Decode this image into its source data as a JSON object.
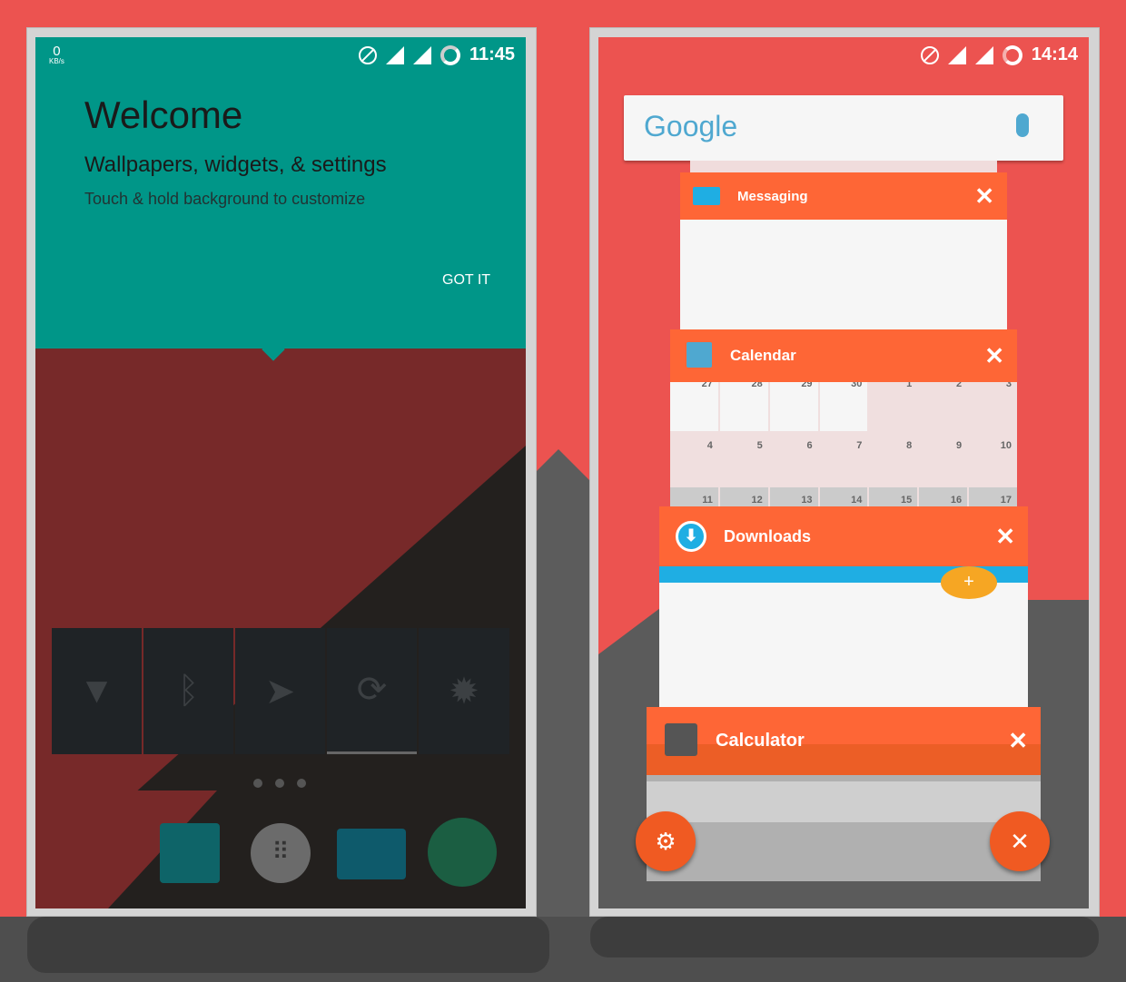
{
  "left_phone": {
    "status": {
      "net_speed": "0",
      "net_unit": "KB/s",
      "time": "11:45"
    },
    "welcome": {
      "title": "Welcome",
      "subtitle": "Wallpapers, widgets, & settings",
      "hint": "Touch & hold background to customize",
      "button": "GOT IT"
    },
    "quick_settings": [
      "wifi-icon",
      "bluetooth-icon",
      "location-icon",
      "sync-icon",
      "brightness-icon"
    ],
    "dock": [
      "contacts-icon",
      "app-drawer-icon",
      "messaging-icon",
      "browser-icon"
    ]
  },
  "right_phone": {
    "status": {
      "time": "14:14"
    },
    "search": {
      "logo": "Google"
    },
    "recents": [
      {
        "label": "Messaging",
        "close": "✕"
      },
      {
        "label": "Calendar",
        "close": "✕"
      },
      {
        "label": "Downloads",
        "close": "✕"
      },
      {
        "label": "Calculator",
        "close": "✕"
      }
    ],
    "calendar_days": [
      "27",
      "28",
      "29",
      "30",
      "1",
      "2",
      "3",
      "4",
      "5",
      "6",
      "7",
      "8",
      "9",
      "10",
      "11",
      "12",
      "13",
      "14",
      "15",
      "16",
      "17"
    ],
    "fab_settings": "settings-icon",
    "fab_close": "✕"
  },
  "colors": {
    "teal": "#009688",
    "red": "#ec5350",
    "card_orange": "#fe6636",
    "fab": "#f05a22"
  }
}
